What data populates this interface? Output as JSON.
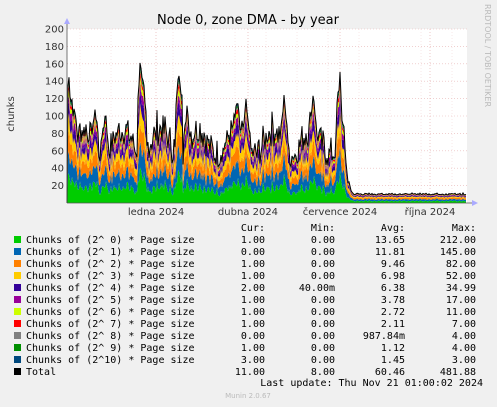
{
  "chart_data": {
    "type": "area",
    "title": "Node 0, zone DMA - by year",
    "ylabel": "chunks",
    "ylim": [
      0,
      200
    ],
    "yticks": [
      20,
      40,
      60,
      80,
      100,
      120,
      140,
      160,
      180,
      200
    ],
    "x_labels": [
      "ledna 2024",
      "dubna 2024",
      "července 2024",
      "října 2024"
    ],
    "grid": true,
    "side_text": "RRDTOOL / TOBI OETIKER",
    "columns": [
      "Cur:",
      "Min:",
      "Avg:",
      "Max:"
    ],
    "series": [
      {
        "name": "Chunks of (2^ 0) * Page size",
        "color": "#00cc00",
        "cur": "1.00",
        "min": "0.00",
        "avg": "13.65",
        "max": "212.00"
      },
      {
        "name": "Chunks of (2^ 1) * Page size",
        "color": "#0066b3",
        "cur": "0.00",
        "min": "0.00",
        "avg": "11.81",
        "max": "145.00"
      },
      {
        "name": "Chunks of (2^ 2) * Page size",
        "color": "#ff8000",
        "cur": "1.00",
        "min": "0.00",
        "avg": "9.46",
        "max": "82.00"
      },
      {
        "name": "Chunks of (2^ 3) * Page size",
        "color": "#ffcc00",
        "cur": "1.00",
        "min": "0.00",
        "avg": "6.98",
        "max": "52.00"
      },
      {
        "name": "Chunks of (2^ 4) * Page size",
        "color": "#330099",
        "cur": "2.00",
        "min": "40.00m",
        "avg": "6.38",
        "max": "34.99"
      },
      {
        "name": "Chunks of (2^ 5) * Page size",
        "color": "#990099",
        "cur": "1.00",
        "min": "0.00",
        "avg": "3.78",
        "max": "17.00"
      },
      {
        "name": "Chunks of (2^ 6) * Page size",
        "color": "#ccff00",
        "cur": "1.00",
        "min": "0.00",
        "avg": "2.72",
        "max": "11.00"
      },
      {
        "name": "Chunks of (2^ 7) * Page size",
        "color": "#ff0000",
        "cur": "1.00",
        "min": "0.00",
        "avg": "2.11",
        "max": "7.00"
      },
      {
        "name": "Chunks of (2^ 8) * Page size",
        "color": "#808080",
        "cur": "0.00",
        "min": "0.00",
        "avg": "987.84m",
        "max": "4.00"
      },
      {
        "name": "Chunks of (2^ 9) * Page size",
        "color": "#008f00",
        "cur": "1.00",
        "min": "0.00",
        "avg": "1.12",
        "max": "4.00"
      },
      {
        "name": "Chunks of (2^10) * Page size",
        "color": "#00487d",
        "cur": "3.00",
        "min": "0.00",
        "avg": "1.45",
        "max": "3.00"
      },
      {
        "name": "Total",
        "color": "#000000",
        "cur": "11.00",
        "min": "8.00",
        "avg": "60.46",
        "max": "481.88"
      }
    ]
  },
  "last_update": "Last update: Thu Nov 21 01:00:02 2024",
  "footer": "Munin 2.0.67"
}
